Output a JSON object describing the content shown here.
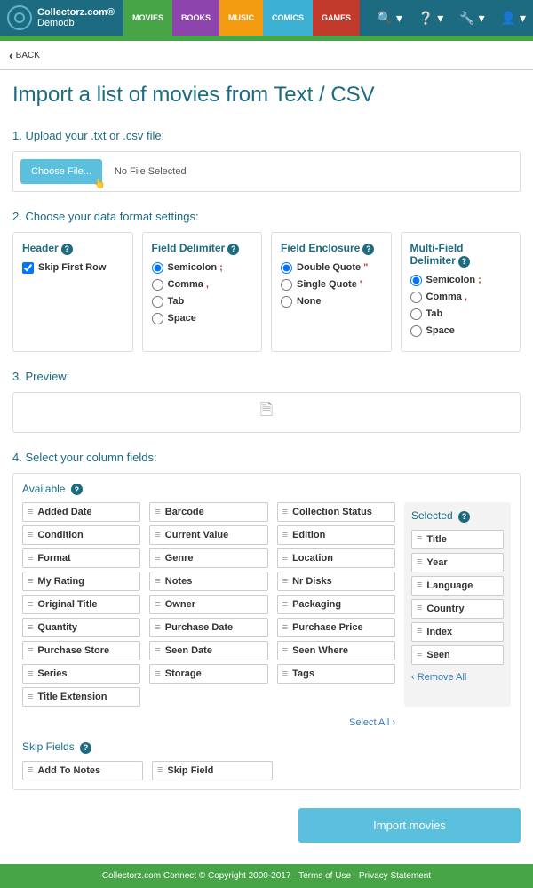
{
  "brand": {
    "name": "Collectorz.com®",
    "sub": "Demodb"
  },
  "tabs": [
    "MOVIES",
    "BOOKS",
    "MUSIC",
    "COMICS",
    "GAMES"
  ],
  "back": "BACK",
  "title": "Import a list of movies from Text / CSV",
  "step1": "1. Upload your .txt or .csv file:",
  "choose": "Choose File...",
  "nofile": "No File Selected",
  "step2": "2. Choose your data format settings:",
  "header_panel": {
    "title": "Header",
    "opt": "Skip First Row"
  },
  "field_delim": {
    "title": "Field Delimiter",
    "opts": [
      "Semicolon",
      "Comma",
      "Tab",
      "Space"
    ],
    "syms": [
      ";",
      ",",
      "",
      ""
    ]
  },
  "field_enc": {
    "title": "Field Enclosure",
    "opts": [
      "Double Quote",
      "Single Quote",
      "None"
    ],
    "syms": [
      "\"",
      "'",
      ""
    ]
  },
  "multi_delim": {
    "title": "Multi-Field Delimiter",
    "opts": [
      "Semicolon",
      "Comma",
      "Tab",
      "Space"
    ],
    "syms": [
      ";",
      ",",
      "",
      ""
    ]
  },
  "step3": "3. Preview:",
  "step4": "4. Select your column fields:",
  "avail_title": "Available",
  "avail": [
    [
      "Added Date",
      "Condition",
      "Format",
      "My Rating",
      "Original Title",
      "Quantity",
      "Purchase Store",
      "Series",
      "Title Extension"
    ],
    [
      "Barcode",
      "Current Value",
      "Genre",
      "Notes",
      "Owner",
      "Purchase Date",
      "Seen Date",
      "Storage"
    ],
    [
      "Collection Status",
      "Edition",
      "Location",
      "Nr Disks",
      "Packaging",
      "Purchase Price",
      "Seen Where",
      "Tags"
    ]
  ],
  "selected_title": "Selected",
  "selected": [
    "Title",
    "Year",
    "Language",
    "Country",
    "Index",
    "Seen"
  ],
  "remove": "Remove All",
  "selectall": "Select All",
  "skip_title": "Skip Fields",
  "skip": [
    "Add To Notes",
    "Skip Field"
  ],
  "import_btn": "Import movies",
  "footer": {
    "brand": "Collectorz.com",
    "copy": " Connect © Copyright 2000-2017 · ",
    "terms": "Terms of Use",
    "dot": " · ",
    "priv": "Privacy Statement"
  }
}
